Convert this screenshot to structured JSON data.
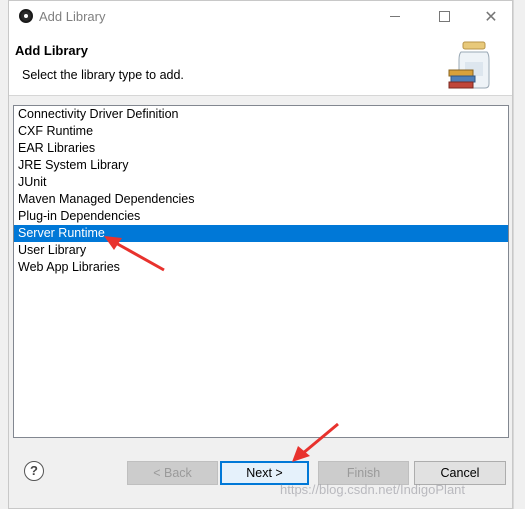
{
  "window": {
    "title": "Add Library"
  },
  "header": {
    "title": "Add Library",
    "description": "Select the library type to add."
  },
  "library_types": [
    {
      "label": "Connectivity Driver Definition",
      "selected": false
    },
    {
      "label": "CXF Runtime",
      "selected": false
    },
    {
      "label": "EAR Libraries",
      "selected": false
    },
    {
      "label": "JRE System Library",
      "selected": false
    },
    {
      "label": "JUnit",
      "selected": false
    },
    {
      "label": "Maven Managed Dependencies",
      "selected": false
    },
    {
      "label": "Plug-in Dependencies",
      "selected": false
    },
    {
      "label": "Server Runtime",
      "selected": true
    },
    {
      "label": "User Library",
      "selected": false
    },
    {
      "label": "Web App Libraries",
      "selected": false
    }
  ],
  "buttons": {
    "help": "?",
    "back": "< Back",
    "next": "Next >",
    "finish": "Finish",
    "cancel": "Cancel"
  },
  "watermark": "https://blog.csdn.net/IndigoPlant",
  "colors": {
    "selection": "#0078d7",
    "annotation_arrow": "#e8322d"
  },
  "icons": {
    "app": "eclipse-icon",
    "header": "library-jar-icon"
  }
}
